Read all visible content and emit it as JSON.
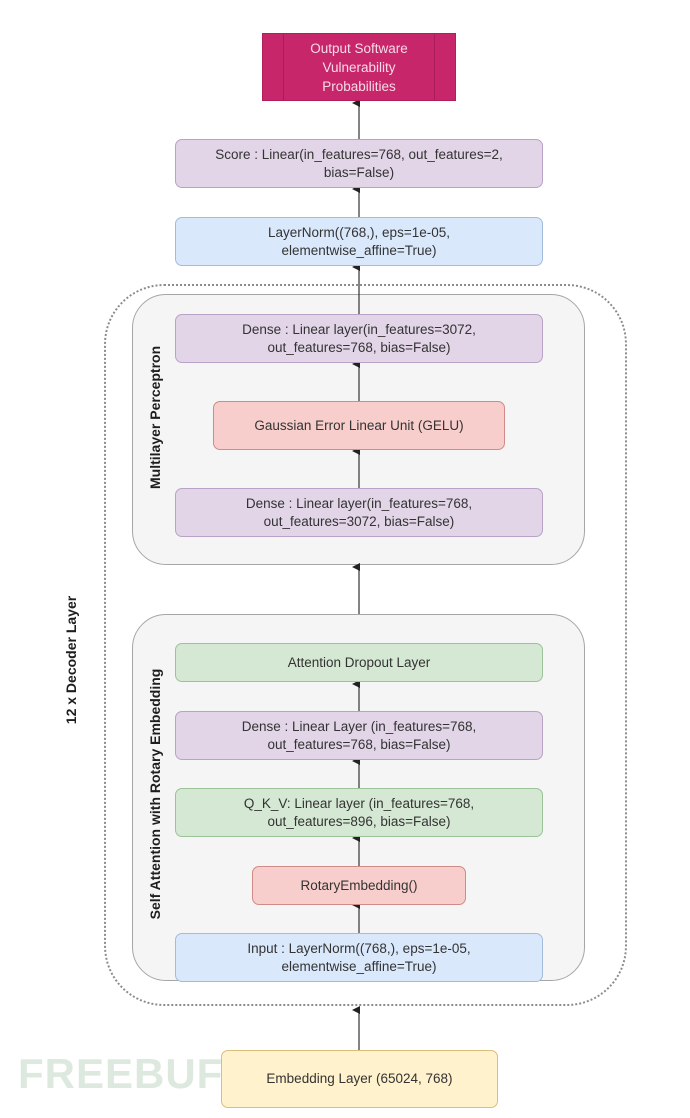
{
  "diagram": {
    "output": {
      "label": "Output Software Vulnerability Probabilities",
      "lines": [
        "Output Software",
        "Vulnerability",
        "Probabilities"
      ]
    },
    "score": {
      "lines": [
        "Score : Linear(in_features=768, out_features=2,",
        "bias=False)"
      ]
    },
    "final_norm": {
      "lines": [
        "LayerNorm((768,), eps=1e-05,",
        "elementwise_affine=True)"
      ]
    },
    "decoder_group": {
      "label": "12 x Decoder Layer"
    },
    "mlp": {
      "label": "Multilayer Perceptron",
      "dense_out": {
        "lines": [
          "Dense : Linear layer(in_features=3072,",
          "out_features=768, bias=False)"
        ]
      },
      "gelu": {
        "label": "Gaussian Error Linear Unit (GELU)"
      },
      "dense_in": {
        "lines": [
          "Dense : Linear layer(in_features=768,",
          "out_features=3072, bias=False)"
        ]
      }
    },
    "attention": {
      "label": "Self Attention with Rotary Embedding",
      "dropout": {
        "label": "Attention Dropout Layer"
      },
      "dense": {
        "lines": [
          "Dense : Linear Layer (in_features=768,",
          "out_features=768, bias=False)"
        ]
      },
      "qkv": {
        "lines": [
          "Q_K_V: Linear layer (in_features=768,",
          "out_features=896, bias=False)"
        ]
      },
      "rotary": {
        "label": "RotaryEmbedding()"
      },
      "input_norm": {
        "lines": [
          "Input : LayerNorm((768,), eps=1e-05,",
          "elementwise_affine=True)"
        ]
      }
    },
    "embedding": {
      "label": "Embedding Layer (65024, 768)"
    }
  },
  "watermark": "FREEBUF",
  "colors": {
    "output": "#c8266b",
    "linear": "#e1d5e7",
    "norm": "#dae8fc",
    "activation": "#f8cecc",
    "attention_misc": "#d5e8d4",
    "embedding": "#fff2cc"
  }
}
